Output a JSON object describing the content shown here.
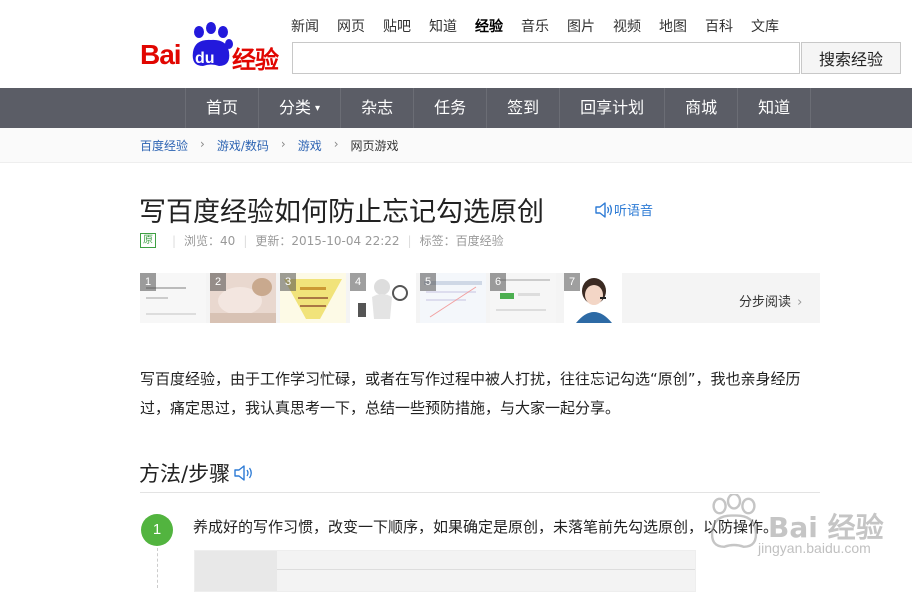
{
  "brand": {
    "logo_text_left": "Bai",
    "logo_text_paw": "du",
    "logo_text_right": "经验",
    "color": "#e10601"
  },
  "top_nav": {
    "items": [
      "新闻",
      "网页",
      "贴吧",
      "知道",
      "经验",
      "音乐",
      "图片",
      "视频",
      "地图",
      "百科",
      "文库"
    ],
    "active": "经验"
  },
  "search": {
    "value": "",
    "button_label": "搜索经验"
  },
  "main_nav": {
    "items": [
      "首页",
      "分类",
      "杂志",
      "任务",
      "签到",
      "回享计划",
      "商城",
      "知道"
    ],
    "dropdown_item": "分类"
  },
  "breadcrumb": [
    "百度经验",
    "游戏/数码",
    "游戏",
    "网页游戏"
  ],
  "article": {
    "title": "写百度经验如何防止忘记勾选原创",
    "listen_label": "听语音",
    "original_badge": "原",
    "views_label": "浏览：40",
    "updated_label": "更新：2015-10-04 22:22",
    "tags_label": "标签：百度经验",
    "thumbnails": [
      "1",
      "2",
      "3",
      "4",
      "5",
      "6",
      "7"
    ],
    "step_read_label": "分步阅读",
    "intro": "写百度经验，由于工作学习忙碌，或者在写作过程中被人打扰，往往忘记勾选“原创”，我也亲身经历过，痛定思过，我认真思考一下，总结一些预防措施，与大家一起分享。",
    "section_title": "方法/步骤",
    "steps": [
      {
        "number": "1",
        "text": "养成好的写作习惯，改变一下顺序，如果确定是原创，未落笔前先勾选原创，以防操作。"
      }
    ]
  },
  "watermark": {
    "text": "Bai 经验",
    "url": "jingyan.baidu.com"
  },
  "colors": {
    "nav_bg": "#5b5d66",
    "accent_green": "#52b43f",
    "link_blue": "#2d64b3",
    "listen_blue": "#2d7bd5"
  }
}
